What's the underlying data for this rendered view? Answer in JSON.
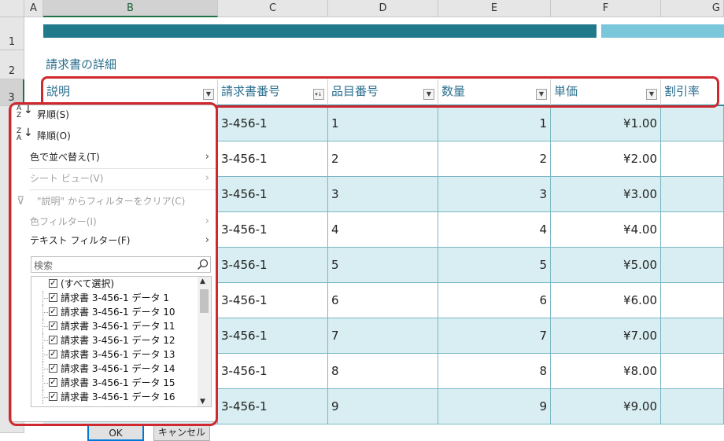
{
  "columns": [
    "A",
    "B",
    "C",
    "D",
    "E",
    "F",
    "G"
  ],
  "rows": [
    "1",
    "2",
    "3"
  ],
  "section_title": "請求書の詳細",
  "headers": [
    "説明",
    "請求書番号",
    "品目番号",
    "数量",
    "単価",
    "割引率"
  ],
  "data_rows": [
    {
      "invoice": "3-456-1",
      "item": "1",
      "qty": "1",
      "price": "¥1.00"
    },
    {
      "invoice": "3-456-1",
      "item": "2",
      "qty": "2",
      "price": "¥2.00"
    },
    {
      "invoice": "3-456-1",
      "item": "3",
      "qty": "3",
      "price": "¥3.00"
    },
    {
      "invoice": "3-456-1",
      "item": "4",
      "qty": "4",
      "price": "¥4.00"
    },
    {
      "invoice": "3-456-1",
      "item": "5",
      "qty": "5",
      "price": "¥5.00"
    },
    {
      "invoice": "3-456-1",
      "item": "6",
      "qty": "6",
      "price": "¥6.00"
    },
    {
      "invoice": "3-456-1",
      "item": "7",
      "qty": "7",
      "price": "¥7.00"
    },
    {
      "invoice": "3-456-1",
      "item": "8",
      "qty": "8",
      "price": "¥8.00"
    },
    {
      "invoice": "3-456-1",
      "item": "9",
      "qty": "9",
      "price": "¥9.00"
    }
  ],
  "filter_menu": {
    "sort_asc": "昇順(S)",
    "sort_desc": "降順(O)",
    "sort_by_color": "色で並べ替え(T)",
    "sheet_view": "シート ビュー(V)",
    "clear_filter": "\"説明\" からフィルターをクリア(C)",
    "color_filter": "色フィルター(I)",
    "text_filter": "テキスト フィルター(F)",
    "search_placeholder": "検索",
    "items": [
      "(すべて選択)",
      "請求書 3-456-1 データ 1",
      "請求書 3-456-1 データ 10",
      "請求書 3-456-1 データ 11",
      "請求書 3-456-1 データ 12",
      "請求書 3-456-1 データ 13",
      "請求書 3-456-1 データ 14",
      "請求書 3-456-1 データ 15",
      "請求書 3-456-1 データ 16"
    ],
    "ok": "OK",
    "cancel": "キャンセル"
  },
  "colors": {
    "title_bar_dark": "#217a8b",
    "title_bar_light": "#7ac7dc",
    "band": "#d8eef2",
    "highlight": "#d0282f"
  }
}
